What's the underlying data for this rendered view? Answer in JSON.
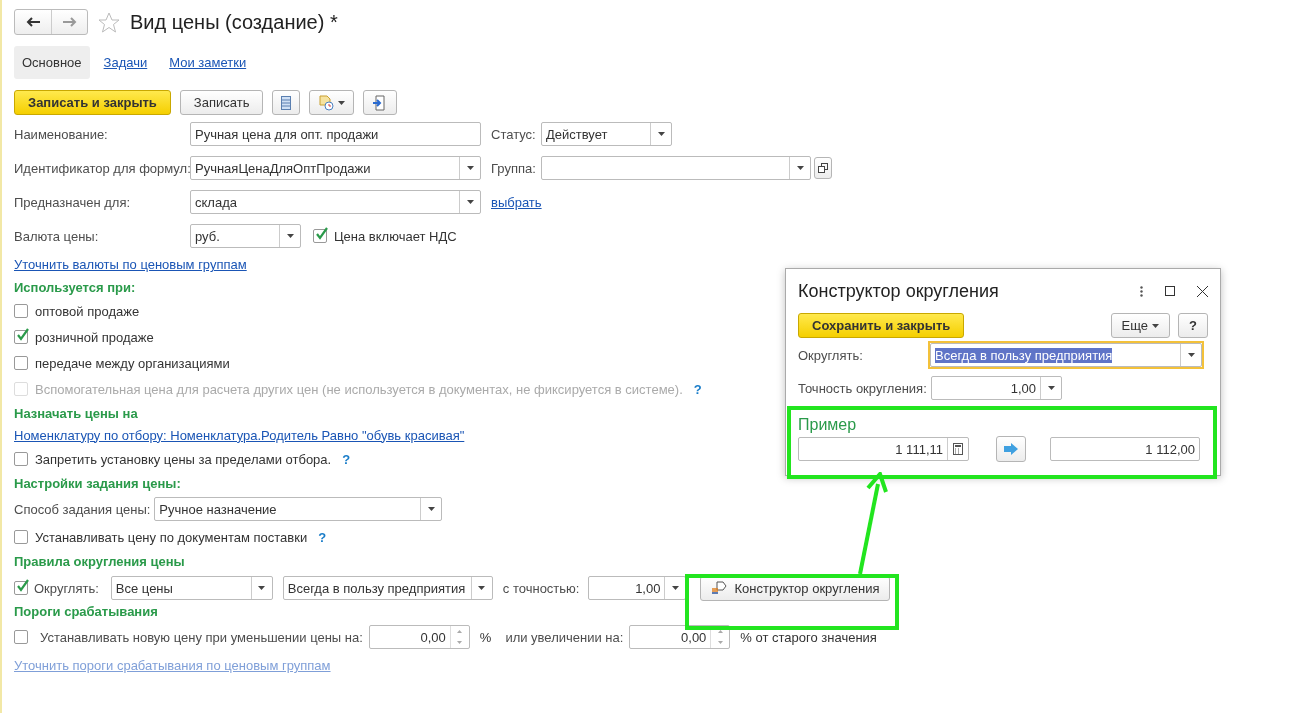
{
  "title": "Вид цены (создание) *",
  "tabs": [
    {
      "label": "Основное",
      "selected": true
    },
    {
      "label": "Задачи",
      "selected": false
    },
    {
      "label": "Мои заметки",
      "selected": false
    }
  ],
  "toolbar": [
    {
      "label": "Записать и закрыть",
      "kind": "primary"
    },
    {
      "label": "Записать",
      "kind": "normal"
    }
  ],
  "name": {
    "label": "Наименование:",
    "value": "Ручная цена для опт. продажи"
  },
  "status": {
    "label": "Статус:",
    "value": "Действует"
  },
  "formula_id": {
    "label": "Идентификатор для формул:",
    "value": "РучнаяЦенаДляОптПродажи"
  },
  "group": {
    "label": "Группа:"
  },
  "purpose": {
    "label": "Предназначен для:",
    "value": "склада",
    "link": "выбрать"
  },
  "currency": {
    "label": "Валюта цены:",
    "value": "руб."
  },
  "vat": {
    "label": "Цена включает НДС",
    "checked": true
  },
  "currency_link": "Уточнить валюты по ценовым группам",
  "used_for": {
    "heading": "Используется при:",
    "items": [
      {
        "label": "оптовой продаже",
        "checked": false,
        "disabled": false
      },
      {
        "label": "розничной продаже",
        "checked": true,
        "disabled": false
      },
      {
        "label": "передаче между организациями",
        "checked": false,
        "disabled": false
      },
      {
        "label": "Вспомогательная цена для расчета других цен (не используется в документах, не фиксируется в системе).",
        "checked": false,
        "disabled": true,
        "help": "?"
      }
    ]
  },
  "assign": {
    "heading": "Назначать цены на",
    "link": "Номенклатуру по отбору: Номенклатура.Родитель Равно \"обувь красивая\"",
    "restrict": {
      "label": "Запретить установку цены за пределами отбора.",
      "checked": false,
      "help": "?"
    }
  },
  "price_setting": {
    "heading": "Настройки задания цены:",
    "method_label": "Способ задания цены:",
    "method": "Ручное назначение",
    "from_supply": {
      "label": "Устанавливать цену по документам поставки",
      "checked": false,
      "help": "?"
    }
  },
  "rounding": {
    "heading": "Правила округления цены",
    "round": {
      "label": "Округлять:",
      "checked": true
    },
    "scope": "Все цены",
    "direction": "Всегда в пользу предприятия",
    "precision_label": "с точностью:",
    "precision": "1,00",
    "constructor_button": "Конструктор округления"
  },
  "thresholds": {
    "heading": "Пороги срабатывания",
    "checkbox": {
      "label": "Устанавливать новую цену при уменьшении цены на:",
      "checked": false
    },
    "decrease": "0,00",
    "percent": "%",
    "increase_label": "или увеличении на:",
    "increase": "0,00",
    "suffix": "% от старого значения",
    "link": "Уточнить пороги срабатывания по ценовым группам"
  },
  "dialog": {
    "title": "Конструктор округления",
    "save_button": "Сохранить и закрыть",
    "more_button": "Еще",
    "help_button": "?",
    "round_label": "Округлять:",
    "round_value": "Всегда в пользу предприятия",
    "precision_label": "Точность округления:",
    "precision": "1,00",
    "example": {
      "heading": "Пример",
      "input": "1 111,11",
      "result": "1 112,00"
    }
  }
}
